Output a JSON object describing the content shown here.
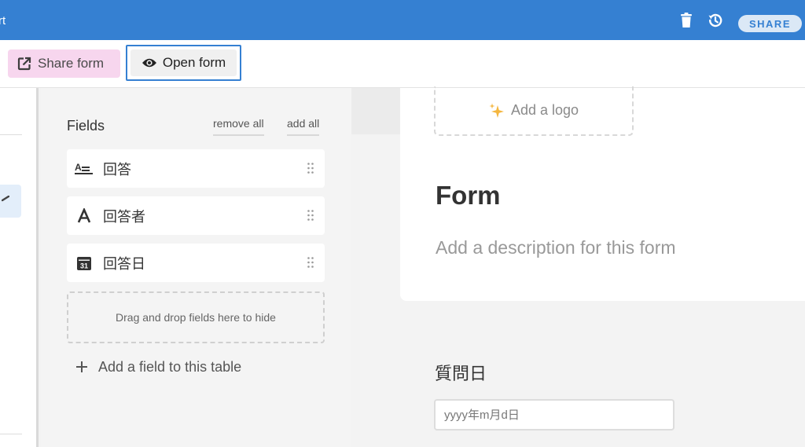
{
  "topbar": {
    "title_fragment": "rt",
    "share_label": "SHARE",
    "icons": [
      "trash-icon",
      "history-icon"
    ],
    "color": "#3580d2"
  },
  "toolbar": {
    "share_form_label": "Share form",
    "open_form_label": "Open form"
  },
  "fields_panel": {
    "title": "Fields",
    "remove_all_label": "remove all",
    "add_all_label": "add all",
    "fields": [
      {
        "label": "回答",
        "icon": "long-text-icon"
      },
      {
        "label": "回答者",
        "icon": "text-icon"
      },
      {
        "label": "回答日",
        "icon": "calendar-icon"
      }
    ],
    "calendar_icon_number": "31",
    "drop_zone_text": "Drag and drop fields here to hide",
    "add_field_label": "Add a field to this table"
  },
  "form": {
    "add_logo_label": "Add a logo",
    "title": "Form",
    "description_placeholder": "Add a description for this form",
    "question_label": "質問日",
    "date_placeholder": "yyyy年m月d日"
  }
}
